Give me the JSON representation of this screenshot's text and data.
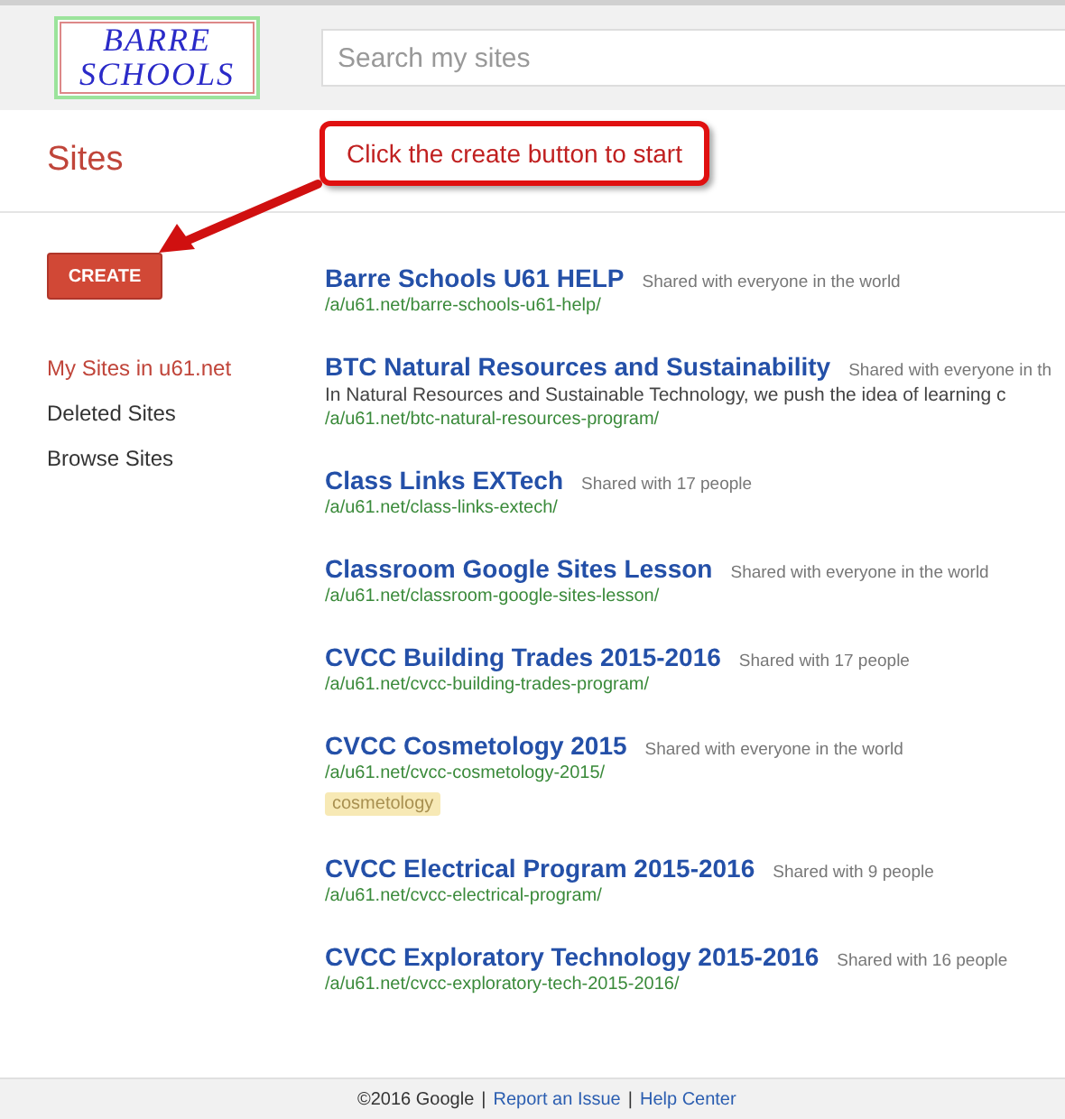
{
  "header": {
    "logo": [
      "BARRE",
      "SCHOOLS"
    ],
    "search": {
      "placeholder": "Search my sites"
    }
  },
  "page_title": "Sites",
  "callout": "Click the create button to start",
  "create_button": "CREATE",
  "nav": [
    {
      "label": "My Sites in u61.net",
      "selected": true
    },
    {
      "label": "Deleted Sites",
      "selected": false
    },
    {
      "label": "Browse Sites",
      "selected": false
    }
  ],
  "sites": [
    {
      "title": "Barre Schools U61 HELP",
      "sharing": "Shared with everyone in the world",
      "url": "/a/u61.net/barre-schools-u61-help/"
    },
    {
      "title": "BTC Natural Resources and Sustainability",
      "sharing": "Shared with everyone in th",
      "description": "In Natural Resources and Sustainable Technology, we push the idea of learning c",
      "url": "/a/u61.net/btc-natural-resources-program/"
    },
    {
      "title": "Class Links EXTech",
      "sharing": "Shared with 17 people",
      "url": "/a/u61.net/class-links-extech/"
    },
    {
      "title": "Classroom Google Sites Lesson",
      "sharing": "Shared with everyone in the world",
      "url": "/a/u61.net/classroom-google-sites-lesson/"
    },
    {
      "title": "CVCC Building Trades 2015-2016",
      "sharing": "Shared with 17 people",
      "url": "/a/u61.net/cvcc-building-trades-program/"
    },
    {
      "title": "CVCC Cosmetology 2015",
      "sharing": "Shared with everyone in the world",
      "url": "/a/u61.net/cvcc-cosmetology-2015/",
      "tags": [
        "cosmetology"
      ]
    },
    {
      "title": "CVCC Electrical Program 2015-2016",
      "sharing": "Shared with 9 people",
      "url": "/a/u61.net/cvcc-electrical-program/"
    },
    {
      "title": "CVCC Exploratory Technology 2015-2016",
      "sharing": "Shared with 16 people",
      "url": "/a/u61.net/cvcc-exploratory-tech-2015-2016/"
    }
  ],
  "footer": {
    "copyright": "©2016 Google",
    "separator": "|",
    "links": [
      "Report an Issue",
      "Help Center"
    ]
  }
}
